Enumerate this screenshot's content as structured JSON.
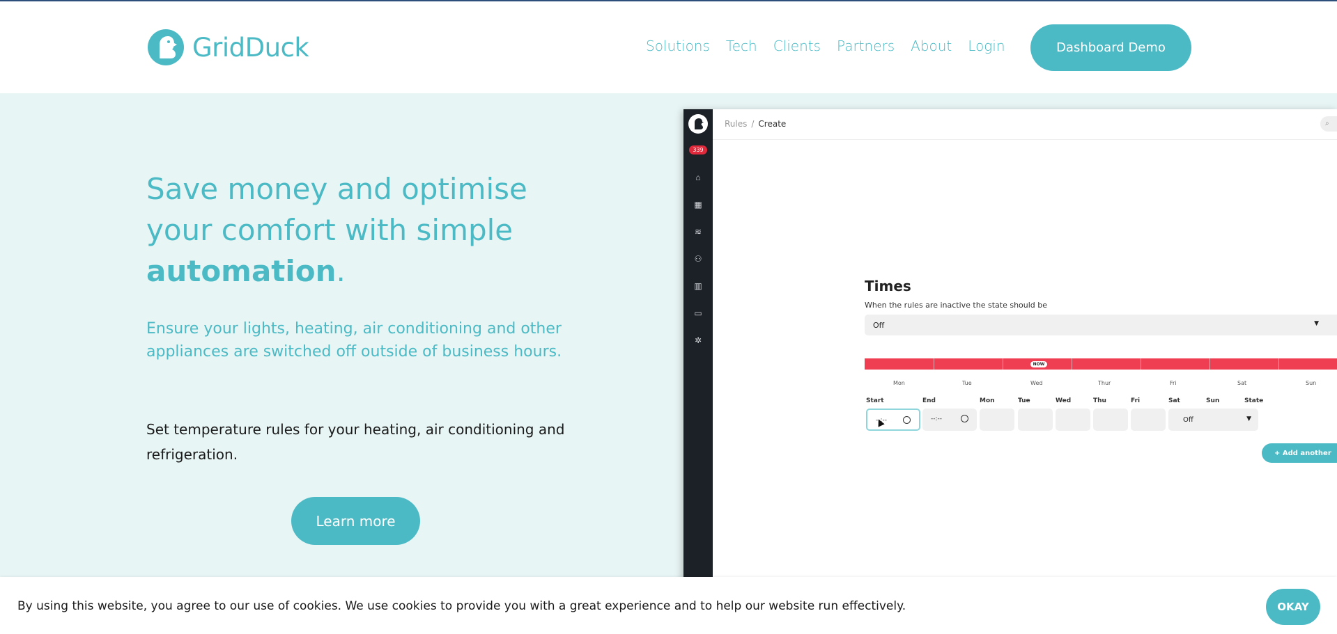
{
  "header": {
    "brand": "GridDuck",
    "nav": [
      "Solutions",
      "Tech",
      "Clients",
      "Partners",
      "About",
      "Login"
    ],
    "cta": "Dashboard Demo"
  },
  "hero": {
    "headline_plain": "Save money and optimise your comfort with simple ",
    "headline_bold": "automation",
    "headline_end": ".",
    "subhead": "Ensure your lights, heating, air conditioning and other appliances are switched off outside of business hours.",
    "body": "Set temperature rules for your heating, air conditioning and refrigeration.",
    "button": "Learn more"
  },
  "app": {
    "badge": "339",
    "breadcrumb": [
      "Rules",
      "Create"
    ],
    "breadcrumb_sep": "/",
    "search_icon": "⌕",
    "title": "Times",
    "hint": "When the rules are inactive the state should be",
    "state_value": "Off",
    "now_label": "NOW",
    "days": [
      "Mon",
      "Tue",
      "Wed",
      "Thur",
      "Fri",
      "Sat",
      "Sun"
    ],
    "columns": [
      "Start",
      "End",
      "Mon",
      "Tue",
      "Wed",
      "Thu",
      "Fri",
      "Sat",
      "Sun",
      "State"
    ],
    "start_value": "--:--",
    "end_value": "--:--",
    "row_state": "Off",
    "add_button": "+ Add another",
    "sidebar_icons": [
      "home-icon",
      "calculator-icon",
      "layers-icon",
      "users-icon",
      "chart-icon",
      "laptop-icon",
      "gear-icon"
    ]
  },
  "cookie": {
    "text": "By using this website, you agree to our use of cookies. We use cookies to provide you with a great experience and to help our website run effectively.",
    "button": "OKAY"
  },
  "colors": {
    "brand": "#4bbac5",
    "hero_bg": "#e8f5f5",
    "timeline": "#ef3e52",
    "sidebar": "#1c2027"
  }
}
